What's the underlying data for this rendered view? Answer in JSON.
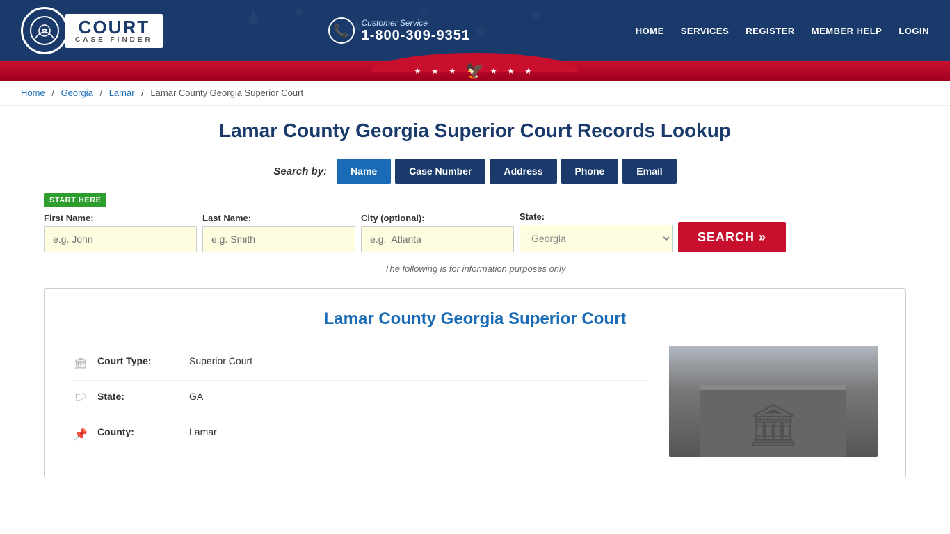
{
  "header": {
    "logo_court": "COURT",
    "logo_case_finder": "CASE FINDER",
    "customer_service_label": "Customer Service",
    "phone_number": "1-800-309-9351",
    "nav": {
      "home": "HOME",
      "services": "SERVICES",
      "register": "REGISTER",
      "member_help": "MEMBER HELP",
      "login": "LOGIN"
    }
  },
  "breadcrumb": {
    "home": "Home",
    "georgia": "Georgia",
    "lamar": "Lamar",
    "current": "Lamar County Georgia Superior Court"
  },
  "page": {
    "title": "Lamar County Georgia Superior Court Records Lookup",
    "search_by_label": "Search by:",
    "tabs": [
      {
        "label": "Name",
        "active": true
      },
      {
        "label": "Case Number",
        "active": false
      },
      {
        "label": "Address",
        "active": false
      },
      {
        "label": "Phone",
        "active": false
      },
      {
        "label": "Email",
        "active": false
      }
    ],
    "start_here": "START HERE",
    "form": {
      "first_name_label": "First Name:",
      "first_name_placeholder": "e.g. John",
      "last_name_label": "Last Name:",
      "last_name_placeholder": "e.g. Smith",
      "city_label": "City (optional):",
      "city_placeholder": "e.g.  Atlanta",
      "state_label": "State:",
      "state_value": "Georgia",
      "search_btn": "SEARCH »"
    },
    "disclaimer": "The following is for information purposes only"
  },
  "court_info": {
    "title": "Lamar County Georgia Superior Court",
    "rows": [
      {
        "icon": "building-icon",
        "label": "Court Type:",
        "value": "Superior Court"
      },
      {
        "icon": "flag-icon",
        "label": "State:",
        "value": "GA"
      },
      {
        "icon": "pin-icon",
        "label": "County:",
        "value": "Lamar"
      }
    ]
  },
  "colors": {
    "navy": "#1a3a6b",
    "blue": "#1a6bb5",
    "red": "#c8102e",
    "green": "#2d9e2d",
    "yellow_bg": "#fffde0"
  }
}
